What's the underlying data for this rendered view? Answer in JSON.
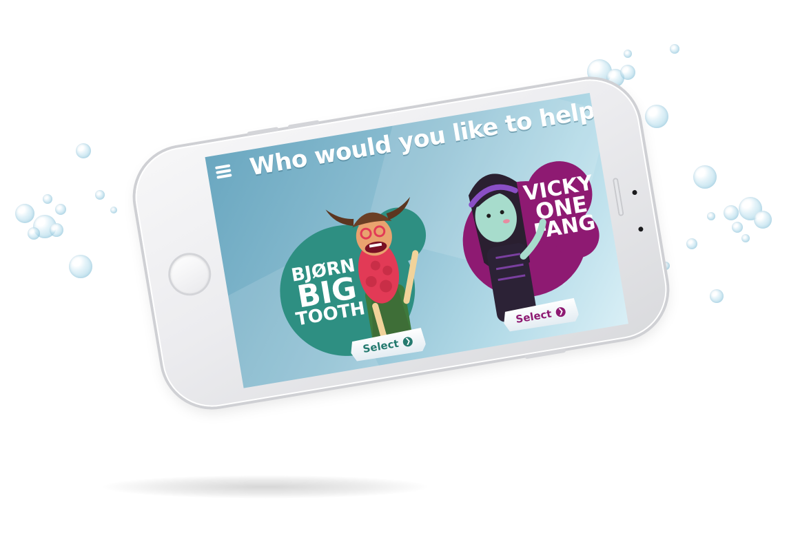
{
  "screen": {
    "title": "Who would you like to help?",
    "menu_icon": "hamburger-menu-icon"
  },
  "characters": [
    {
      "name_lines": [
        "BJØRN",
        "BIG",
        "TOOTH"
      ],
      "select_label": "Select",
      "select_icon": "chevron-right-circle-icon",
      "color": "#2e8f82"
    },
    {
      "name_lines": [
        "VICKY",
        "ONE",
        "FANG"
      ],
      "select_label": "Select",
      "select_icon": "chevron-right-circle-icon",
      "color": "#8e1a72"
    }
  ]
}
